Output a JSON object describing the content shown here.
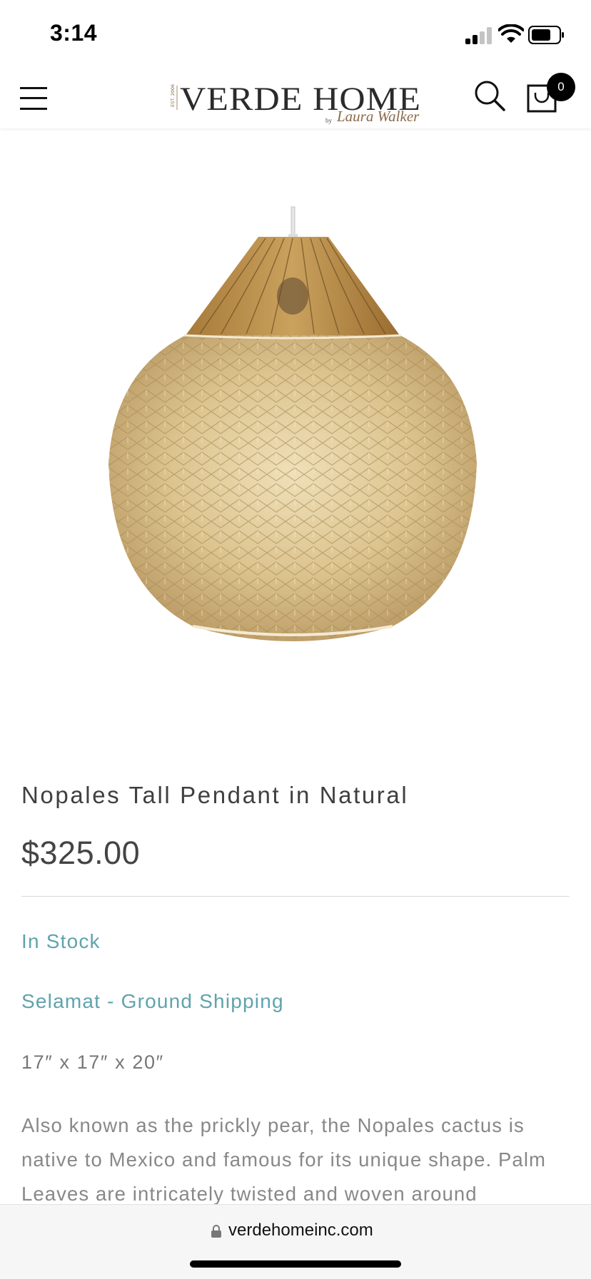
{
  "status_bar": {
    "time": "3:14"
  },
  "header": {
    "logo_text": "VERDE HOME",
    "logo_est": "EST. 2006",
    "logo_by": "by",
    "logo_script": "Laura Walker",
    "cart_count": "0"
  },
  "product": {
    "title": "Nopales Tall Pendant in Natural",
    "price": "$325.00",
    "stock_status": "In Stock",
    "shipping": "Selamat - Ground Shipping",
    "dimensions": "17″ x 17″ x 20″",
    "description": "Also known as the prickly pear, the Nopales cactus is native to Mexico and famous for its unique shape. Palm Leaves are intricately twisted and woven around"
  },
  "browser": {
    "url": "verdehomeinc.com"
  },
  "colors": {
    "accent": "#5fa3ad",
    "text": "#3f3f3f",
    "muted": "#888888",
    "natural": "#dcc48f"
  }
}
